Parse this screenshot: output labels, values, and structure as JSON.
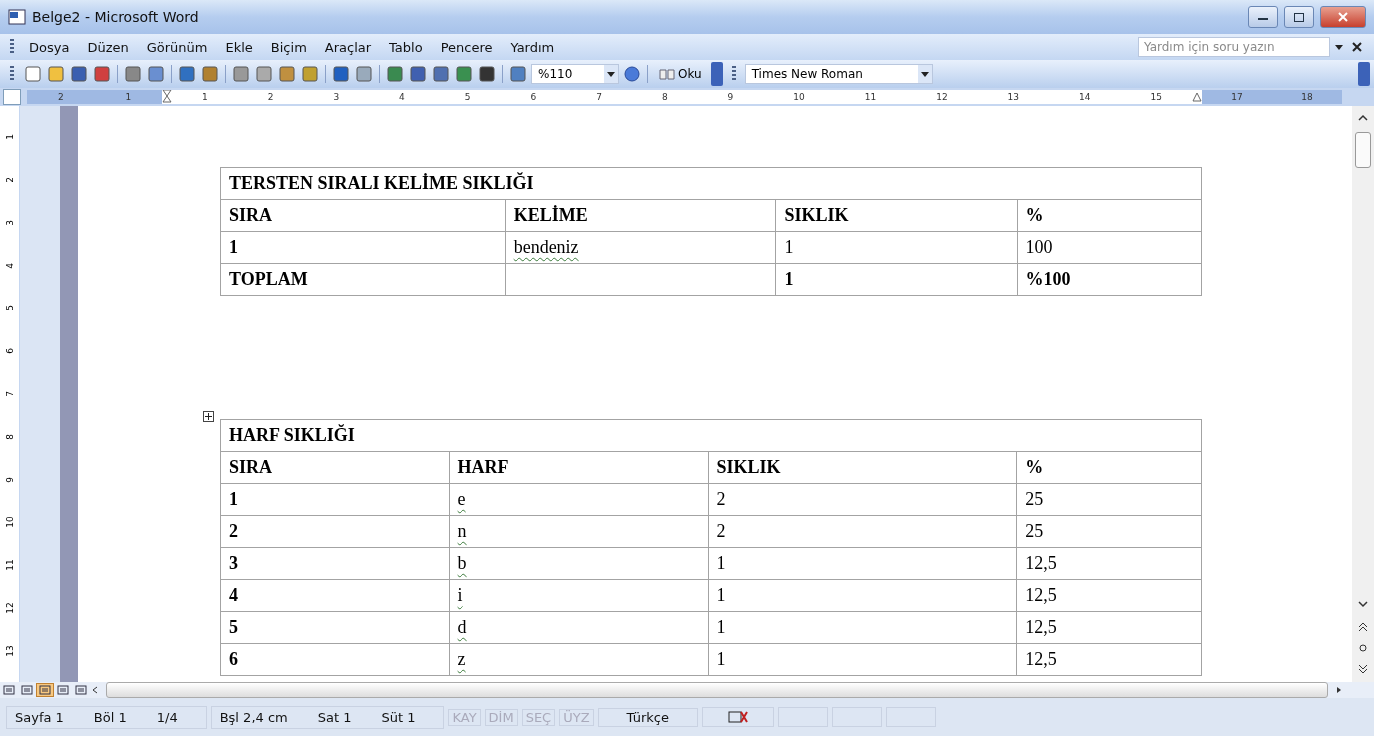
{
  "window": {
    "title": "Belge2 - Microsoft Word"
  },
  "menu": {
    "items": [
      "Dosya",
      "Düzen",
      "Görünüm",
      "Ekle",
      "Biçim",
      "Araçlar",
      "Tablo",
      "Pencere",
      "Yardım"
    ],
    "help_field": {
      "placeholder": "Yardım için soru yazın"
    }
  },
  "toolbar": {
    "zoom": "%110",
    "read_button": "Oku",
    "font": "Times New Roman"
  },
  "ruler": {
    "left_labels": [
      "2",
      "1"
    ],
    "labels": [
      "1",
      "2",
      "3",
      "4",
      "5",
      "6",
      "7",
      "8",
      "9",
      "10",
      "11",
      "12",
      "13",
      "14",
      "15"
    ],
    "right_labels": [
      "17",
      "18"
    ]
  },
  "vertical_ruler": {
    "labels": [
      "1",
      "2",
      "3",
      "4",
      "5",
      "6",
      "7",
      "8",
      "9",
      "10",
      "11",
      "12",
      "13"
    ]
  },
  "tables": [
    {
      "title": "TERSTEN SIRALI KELİME SIKLIĞI",
      "show_move_handle": false,
      "columns": [
        "SIRA",
        "KELİME",
        "SIKLIK",
        "%"
      ],
      "rows": [
        {
          "cells": [
            {
              "text": "1",
              "bold": true
            },
            {
              "text": "bendeniz",
              "misspelled": true
            },
            {
              "text": "1"
            },
            {
              "text": "100"
            }
          ]
        },
        {
          "cells": [
            {
              "text": "TOPLAM",
              "bold": true
            },
            {
              "text": ""
            },
            {
              "text": "1",
              "bold": true
            },
            {
              "text": "%100",
              "bold": true
            }
          ]
        }
      ]
    },
    {
      "title": "HARF SIKLIĞI",
      "show_move_handle": true,
      "columns": [
        "SIRA",
        "HARF",
        "SIKLIK",
        "%"
      ],
      "rows": [
        {
          "cells": [
            {
              "text": "1",
              "bold": true
            },
            {
              "text": "e",
              "misspelled": true
            },
            {
              "text": "2"
            },
            {
              "text": "25"
            }
          ]
        },
        {
          "cells": [
            {
              "text": "2",
              "bold": true
            },
            {
              "text": "n",
              "misspelled": true
            },
            {
              "text": "2"
            },
            {
              "text": "25"
            }
          ]
        },
        {
          "cells": [
            {
              "text": "3",
              "bold": true
            },
            {
              "text": "b",
              "misspelled": true
            },
            {
              "text": "1"
            },
            {
              "text": "12,5"
            }
          ]
        },
        {
          "cells": [
            {
              "text": "4",
              "bold": true
            },
            {
              "text": "i",
              "misspelled": true
            },
            {
              "text": "1"
            },
            {
              "text": "12,5"
            }
          ]
        },
        {
          "cells": [
            {
              "text": "5",
              "bold": true
            },
            {
              "text": "d",
              "misspelled": true
            },
            {
              "text": "1"
            },
            {
              "text": "12,5"
            }
          ]
        },
        {
          "cells": [
            {
              "text": "6",
              "bold": true
            },
            {
              "text": "z",
              "misspelled": true
            },
            {
              "text": "1"
            },
            {
              "text": "12,5"
            }
          ]
        }
      ]
    }
  ],
  "view_buttons": [
    {
      "selected": false
    },
    {
      "selected": false
    },
    {
      "selected": true
    },
    {
      "selected": false
    },
    {
      "selected": false
    }
  ],
  "status_bar": {
    "fields": [
      {
        "text": "Sayfa 1",
        "disabled": false
      },
      {
        "text": "Böl 1",
        "disabled": false
      },
      {
        "text": "1/4",
        "disabled": false
      },
      {
        "text": "Bşl 2,4 cm",
        "disabled": false
      },
      {
        "text": "Sat 1",
        "disabled": false
      },
      {
        "text": "Süt 1",
        "disabled": false
      }
    ],
    "modes": [
      {
        "text": "KAY",
        "disabled": true
      },
      {
        "text": "DİM",
        "disabled": true
      },
      {
        "text": "SEÇ",
        "disabled": true
      },
      {
        "text": "ÜYZ",
        "disabled": true
      }
    ],
    "language": "Türkçe"
  }
}
